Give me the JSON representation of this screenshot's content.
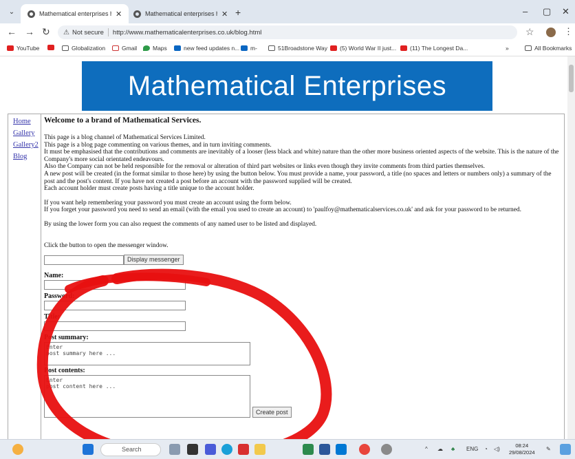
{
  "browser": {
    "tabs": [
      {
        "title": "Mathematical enterprises home",
        "active": true
      },
      {
        "title": "Mathematical enterprises home",
        "active": false
      }
    ],
    "new_tab": "+",
    "address": {
      "security": "Not secure",
      "url": "http://www.mathematicalenterprises.co.uk/blog.html"
    },
    "bookmarks": [
      {
        "label": "YouTube",
        "icon": "youtube-icon"
      },
      {
        "label": "",
        "icon": "youtube-icon"
      },
      {
        "label": "Globalization",
        "icon": "folder-icon"
      },
      {
        "label": "Gmail",
        "icon": "gmail-icon"
      },
      {
        "label": "Maps",
        "icon": "maps-icon"
      },
      {
        "label": "new feed updates n...",
        "icon": "linkedin-icon"
      },
      {
        "label": "m-",
        "icon": "linkedin-icon"
      },
      {
        "label": "51Broadstone Way",
        "icon": "folder-icon"
      },
      {
        "label": "(5) World War II just...",
        "icon": "youtube-icon"
      },
      {
        "label": "(11) The Longest Da...",
        "icon": "youtube-icon"
      }
    ],
    "bookmarks_overflow": "»",
    "all_bookmarks": "All Bookmarks"
  },
  "site": {
    "banner": "Mathematical Enterprises",
    "nav": [
      "Home",
      "Gallery",
      "Gallery2",
      "Blog"
    ],
    "heading": "Welcome to a brand of Mathematical Services.",
    "para1": "This page is a blog channel of Mathematical Services Limited.",
    "para2": "This page is a blog page commenting on various themes, and in turn inviting comments.",
    "para3": "It must be emphasised that the contributions and comments are inevitably of a looser (less black and white) nature than the other more business oriented aspects of the website. This is the nature of the Company's more social orientated endeavours.",
    "para4": "Also the Company can not be held responsible for the removal or alteration of third part websites or links even though they invite comments from third parties themselves.",
    "para5": "A new post will be created (in the format similar to those here) by using the button below. You must provide a name, your password, a title (no spaces and letters or numbers only) a summary of the post and the post's content. If you have not created a post before an account with the password supplied will be created.",
    "para6": "Each account holder must create posts having a title unique to the account holder.",
    "para7": "If you want help remembering your password you must create an account using the form below.",
    "para8": "If you forget your password you need to send an email (with the email you used to create an account) to 'paulfoy@mathematicalservices.co.uk' and ask for your password to be returned.",
    "para9": "By using the lower form you can also request the comments of any named user to be listed and displayed.",
    "para10": "Click the button to open the messenger window.",
    "messenger_button": "Display messenger",
    "form": {
      "name_label": "Name:",
      "password_label": "Password:",
      "title_label": "Title:",
      "summary_label": "Post summary:",
      "summary_value": "Enter\npost summary here ...",
      "contents_label": "Post contents:",
      "contents_value": "Enter\npost content here ...",
      "submit": "Create post"
    }
  },
  "taskbar": {
    "search_placeholder": "Search",
    "tray_lang": "ENG",
    "time": "08:24",
    "date": "29/08/2024"
  },
  "colors": {
    "banner": "#0e6dbd",
    "annotation_circle": "#e81010",
    "link": "#3333aa"
  }
}
